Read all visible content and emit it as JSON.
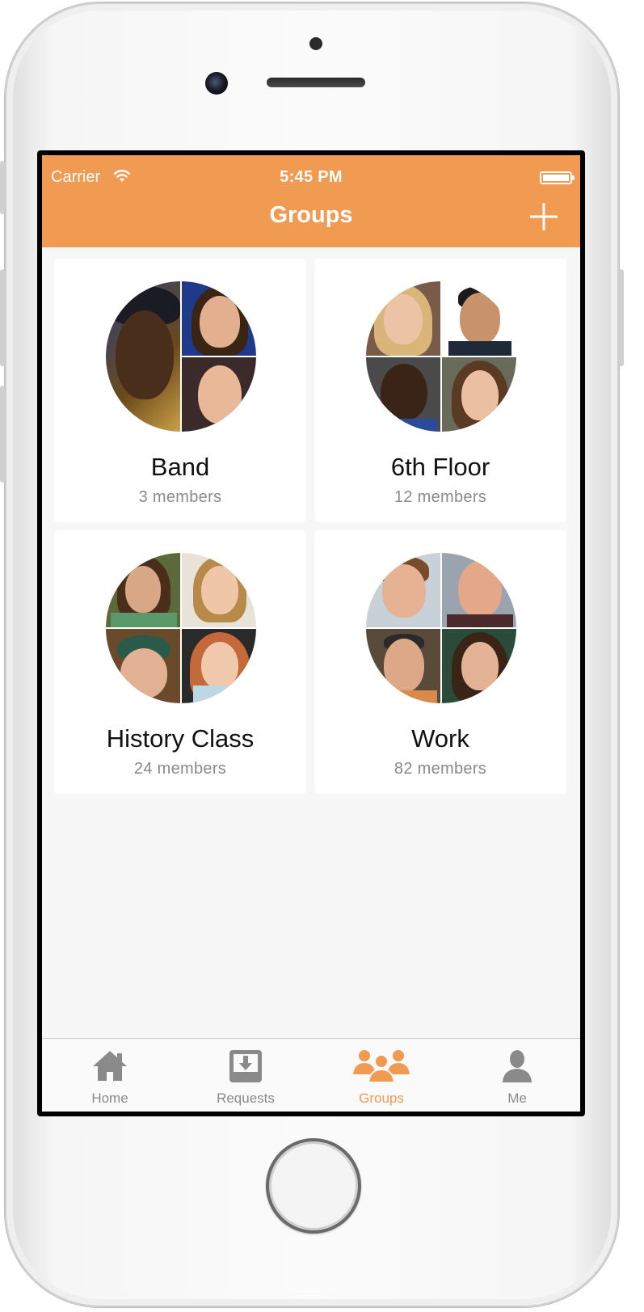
{
  "status_bar": {
    "carrier": "Carrier",
    "time": "5:45 PM"
  },
  "navbar": {
    "title": "Groups",
    "add_icon": "plus-icon"
  },
  "groups": [
    {
      "name": "Band",
      "members": "3 members"
    },
    {
      "name": "6th Floor",
      "members": "12 members"
    },
    {
      "name": "History Class",
      "members": "24 members"
    },
    {
      "name": "Work",
      "members": "82 members"
    }
  ],
  "tabs": [
    {
      "label": "Home",
      "icon": "home-icon"
    },
    {
      "label": "Requests",
      "icon": "inbox-download-icon"
    },
    {
      "label": "Groups",
      "icon": "groups-icon",
      "active": true
    },
    {
      "label": "Me",
      "icon": "person-icon"
    }
  ],
  "colors": {
    "accent": "#f09a52",
    "inactive": "#8a8a8a",
    "background": "#f7f7f7"
  }
}
